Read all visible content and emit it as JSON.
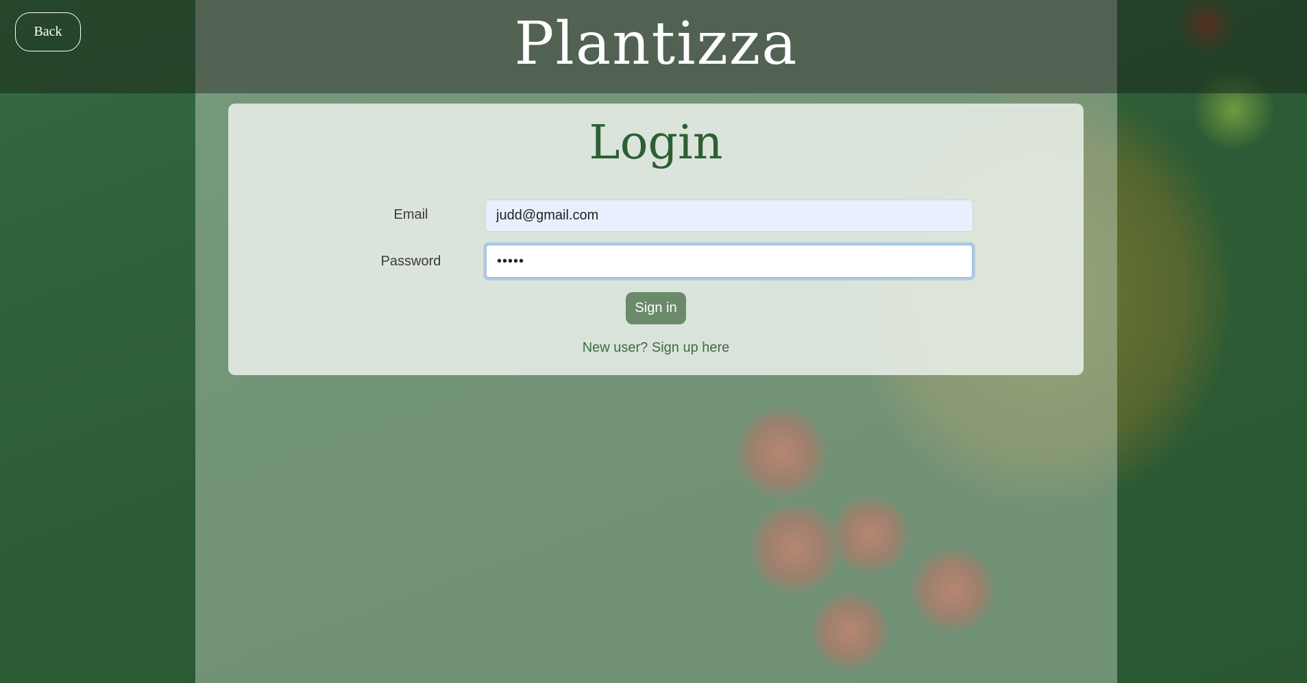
{
  "header": {
    "brand": "Plantizza",
    "back_label": "Back"
  },
  "login": {
    "title": "Login",
    "email_label": "Email",
    "email_value": "judd@gmail.com",
    "password_label": "Password",
    "password_value": "•••••",
    "signin_label": "Sign in",
    "signup_text": "New user? Sign up here"
  },
  "colors": {
    "brand_green": "#2e5e33",
    "button_green": "#6a8a6a",
    "link_green": "#3f6b43"
  }
}
